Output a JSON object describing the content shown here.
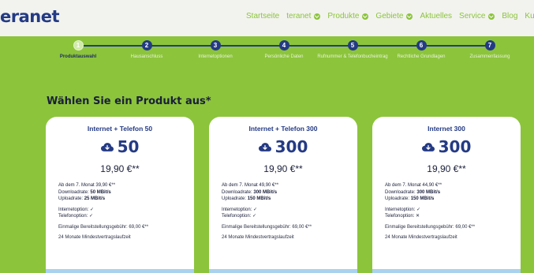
{
  "header": {
    "logo": "eranet",
    "nav": [
      {
        "label": "Startseite",
        "dropdown": false
      },
      {
        "label": "teranet",
        "dropdown": true
      },
      {
        "label": "Produkte",
        "dropdown": true
      },
      {
        "label": "Gebiete",
        "dropdown": true
      },
      {
        "label": "Aktuelles",
        "dropdown": false
      },
      {
        "label": "Service",
        "dropdown": true
      },
      {
        "label": "Blog",
        "dropdown": false
      },
      {
        "label": "Kundenp",
        "dropdown": false
      }
    ]
  },
  "stepper": {
    "steps": [
      {
        "num": "1",
        "label": "Produktauswahl",
        "active": true
      },
      {
        "num": "2",
        "label": "Hausanschluss",
        "active": false
      },
      {
        "num": "3",
        "label": "Internetoptionen",
        "active": false
      },
      {
        "num": "4",
        "label": "Persönliche Daten",
        "active": false
      },
      {
        "num": "5",
        "label": "Rufnummer & Telefonbucheintrag",
        "active": false
      },
      {
        "num": "6",
        "label": "Rechtliche Grundlagen",
        "active": false
      },
      {
        "num": "7",
        "label": "Zusammenfassung",
        "active": false
      }
    ]
  },
  "main": {
    "headline": "Wählen Sie ein Produkt aus*"
  },
  "products": [
    {
      "title": "Internet + Telefon 50",
      "speed": "50",
      "price": "19,90 €**",
      "after": "Ab dem 7. Monat 39,90 €**",
      "download_label": "Downloadrate:",
      "download": "50 MBit/s",
      "upload_label": "Uploadrate:",
      "upload": "25 MBit/s",
      "internet_label": "Internetoption:",
      "internet": "✓",
      "phone_label": "Telefonoption:",
      "phone": "✓",
      "fee": "Einmalige Bereitstellungsgebühr: 69,00 €**",
      "term": "24 Monate Mindestvertragslaufzeit"
    },
    {
      "title": "Internet + Telefon 300",
      "speed": "300",
      "price": "19,90 €**",
      "after": "Ab dem 7. Monat 49,90 €**",
      "download_label": "Downloadrate:",
      "download": "300 MBit/s",
      "upload_label": "Uploadrate:",
      "upload": "150 MBit/s",
      "internet_label": "Internetoption:",
      "internet": "✓",
      "phone_label": "Telefonoption:",
      "phone": "✓",
      "fee": "Einmalige Bereitstellungsgebühr: 69,00 €**",
      "term": "24 Monate Mindestvertragslaufzeit"
    },
    {
      "title": "Internet 300",
      "speed": "300",
      "price": "19,90 €**",
      "after": "Ab dem 7. Monat 44,90 €**",
      "download_label": "Downloadrate:",
      "download": "300 MBit/s",
      "upload_label": "Uploadrate:",
      "upload": "150 MBit/s",
      "internet_label": "Internetoption:",
      "internet": "✓",
      "phone_label": "Telefonoption:",
      "phone": "✕",
      "fee": "Einmalige Bereitstellungsgebühr: 69,00 €**",
      "term": "24 Monate Mindestvertragslaufzeit"
    }
  ],
  "colors": {
    "page_bg": "#8cc43c",
    "brand_blue": "#243a84",
    "header_bg": "#f2f3ee",
    "card_accent": "#a9d2ee"
  },
  "icons": {
    "speed": "cloud-download-icon",
    "nav_dropdown": "chevron-down-icon"
  }
}
